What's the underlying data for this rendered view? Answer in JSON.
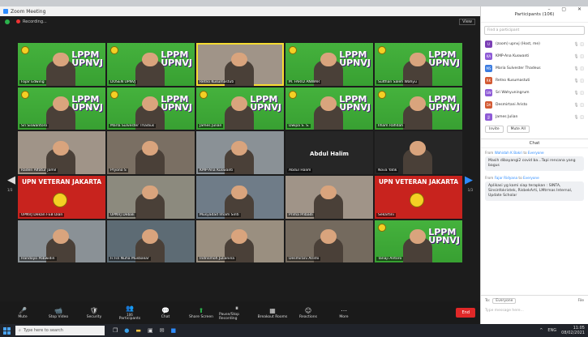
{
  "window_title": "Zoom Meeting",
  "recording_label": "Recording...",
  "view_label": "View",
  "tiles": [
    {
      "name": "Fajar Edwing",
      "style": "green"
    },
    {
      "name": "DOSEN UPNVJ",
      "style": "green"
    },
    {
      "name": "Retno Kusumastuti",
      "style": "photo",
      "active": true
    },
    {
      "name": "M. FARID ANWAR",
      "style": "green"
    },
    {
      "name": "Sulthan Saleh Wahyu",
      "style": "green"
    },
    {
      "name": "Sri Siswantoro",
      "style": "green"
    },
    {
      "name": "Marla Sulvester Thadius",
      "style": "green"
    },
    {
      "name": "James Julian",
      "style": "green"
    },
    {
      "name": "Dwipa S. S.",
      "style": "green"
    },
    {
      "name": "Ilham Rafidah",
      "style": "green"
    },
    {
      "name": "Raden Alfatur Jamil",
      "style": "photo"
    },
    {
      "name": "Pryono S",
      "style": "photo"
    },
    {
      "name": "KMP-Ana Kuswanti",
      "style": "photo"
    },
    {
      "name": "Abdul Halim",
      "style": "nameonly"
    },
    {
      "name": "Nova Yatik",
      "style": "dark"
    },
    {
      "name": "UPNVJ Dekan FEB Dian",
      "style": "upn",
      "banner": "UPN VETERAN JAKARTA"
    },
    {
      "name": "UPNVJ Debali",
      "style": "photo"
    },
    {
      "name": "Musyadad Imam Sinti",
      "style": "photo"
    },
    {
      "name": "Prima Pribadi",
      "style": "photo"
    },
    {
      "name": "Sekartini",
      "style": "upn",
      "banner": "UPN VETERAN JAKARTA"
    },
    {
      "name": "Handoyo Pobwidin",
      "style": "photo"
    },
    {
      "name": "Fi Fin Nuha Musbaliar",
      "style": "photo"
    },
    {
      "name": "Indrismoh Julianina",
      "style": "photo"
    },
    {
      "name": "Desmirani Aristo",
      "style": "photo"
    },
    {
      "name": "Tanaji Antoro",
      "style": "green"
    }
  ],
  "lppm_text": [
    "LPPM",
    "UPNVJ"
  ],
  "page_left": "1/3",
  "page_right": "1/3",
  "toolbar": [
    {
      "label": "Mute",
      "icon": "🎤"
    },
    {
      "label": "Stop Video",
      "icon": "📹"
    },
    {
      "label": "Security",
      "icon": "🛡"
    },
    {
      "label": "Participants",
      "icon": "👥",
      "count": "106"
    },
    {
      "label": "Chat",
      "icon": "💬"
    },
    {
      "label": "Share Screen",
      "icon": "⬆"
    },
    {
      "label": "Pause/Stop Recording",
      "icon": "⏸"
    },
    {
      "label": "Breakout Rooms",
      "icon": "▦"
    },
    {
      "label": "Reactions",
      "icon": "☺"
    },
    {
      "label": "More",
      "icon": "⋯"
    }
  ],
  "end_label": "End",
  "participants": {
    "title": "Participants (106)",
    "search_placeholder": "Find a participant",
    "list": [
      {
        "initials": "U",
        "name": "(zoom) upnvj (Host, me)",
        "color": "#7b3fb5"
      },
      {
        "initials": "KA",
        "name": "KMP-Ana Kuswanti",
        "color": "#8e5bd6"
      },
      {
        "initials": "MS",
        "name": "Maria Sulvester Thadeus",
        "color": "#3a7be0"
      },
      {
        "initials": "RK",
        "name": "Retno Kusumastuti",
        "color": "#d35a33"
      },
      {
        "initials": "SW",
        "name": "Sri Wahyuningrum",
        "color": "#8e5bd6"
      },
      {
        "initials": "DA",
        "name": "Desmirtani Aristo",
        "color": "#d35a33"
      },
      {
        "initials": "JJ",
        "name": "James Julian",
        "color": "#8e5bd6"
      }
    ],
    "invite_label": "Invite",
    "mute_all_label": "Mute All"
  },
  "chat": {
    "title": "Chat",
    "messages": [
      {
        "from": "Wahidah K Bakri",
        "to": "Everyone",
        "text": "Masih dibayangi2 covid ba...Tapi rencana yang bagus"
      },
      {
        "from": "Fajar Ridyana",
        "to": "Everyone",
        "text": "Aplikasi yg kami siap terapkan : SINTA, Sinsinfokristek, RisbekArti, LMtrmas Internal, Update Scholar"
      }
    ],
    "to_label": "To:",
    "to_value": "Everyone",
    "file_label": "File",
    "input_placeholder": "Type message here..."
  },
  "taskbar": {
    "search_placeholder": "Type here to search",
    "lang": "ENG",
    "time": "11:05",
    "date": "08/02/2021"
  }
}
